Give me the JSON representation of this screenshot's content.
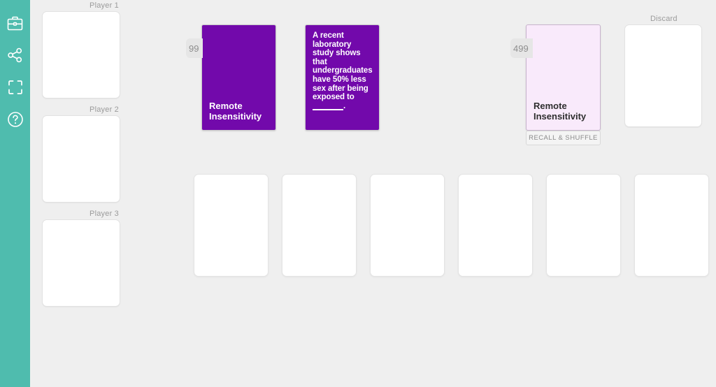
{
  "theme": {
    "sidebar_color": "#4fbcae",
    "background": "#efefef",
    "card_purple": "#7209ab",
    "card_lavender": "#f9eafb",
    "label_gray": "#9b9b9b"
  },
  "sidebar": {
    "items": [
      {
        "icon": "briefcase-icon",
        "name": "sidebar-item-briefcase"
      },
      {
        "icon": "share-icon",
        "name": "sidebar-item-share"
      },
      {
        "icon": "fullscreen-icon",
        "name": "sidebar-item-fullscreen"
      },
      {
        "icon": "help-icon",
        "name": "sidebar-item-help"
      }
    ]
  },
  "players": [
    {
      "label": "Player 1"
    },
    {
      "label": "Player 2"
    },
    {
      "label": "Player 3"
    }
  ],
  "draw_deck": {
    "count": "99",
    "title": "Remote Insensitivity"
  },
  "played_card": {
    "text_before_blank": "A recent laboratory study shows that undergraduates have 50% less sex after being exposed to",
    "text_after_blank": "."
  },
  "discard_deck": {
    "count": "499",
    "title": "Remote Insensitivity",
    "recall_label": "RECALL & SHUFFLE"
  },
  "discard_pile": {
    "label": "Discard"
  },
  "hand": {
    "cards": [
      {
        "index": "1"
      },
      {
        "index": "2"
      },
      {
        "index": "3"
      },
      {
        "index": "4"
      },
      {
        "index": "5"
      },
      {
        "index": "6"
      }
    ]
  }
}
